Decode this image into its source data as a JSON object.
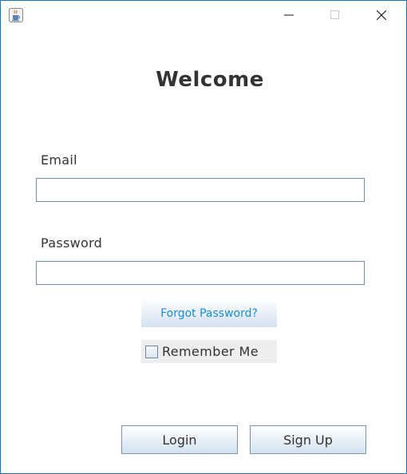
{
  "window": {
    "icon": "java-cup-icon",
    "controls": {
      "minimize_icon": "minimize-icon",
      "maximize_icon": "maximize-icon",
      "close_icon": "close-icon"
    }
  },
  "form": {
    "title": "Welcome",
    "email": {
      "label": "Email",
      "value": ""
    },
    "password": {
      "label": "Password",
      "value": ""
    },
    "forgot_password_label": "Forgot Password?",
    "remember_me": {
      "label": "Remember Me",
      "checked": false
    },
    "login_label": "Login",
    "signup_label": "Sign Up"
  },
  "colors": {
    "window_border": "#1e73be",
    "link_text": "#1a8fd6",
    "text": "#333333"
  }
}
